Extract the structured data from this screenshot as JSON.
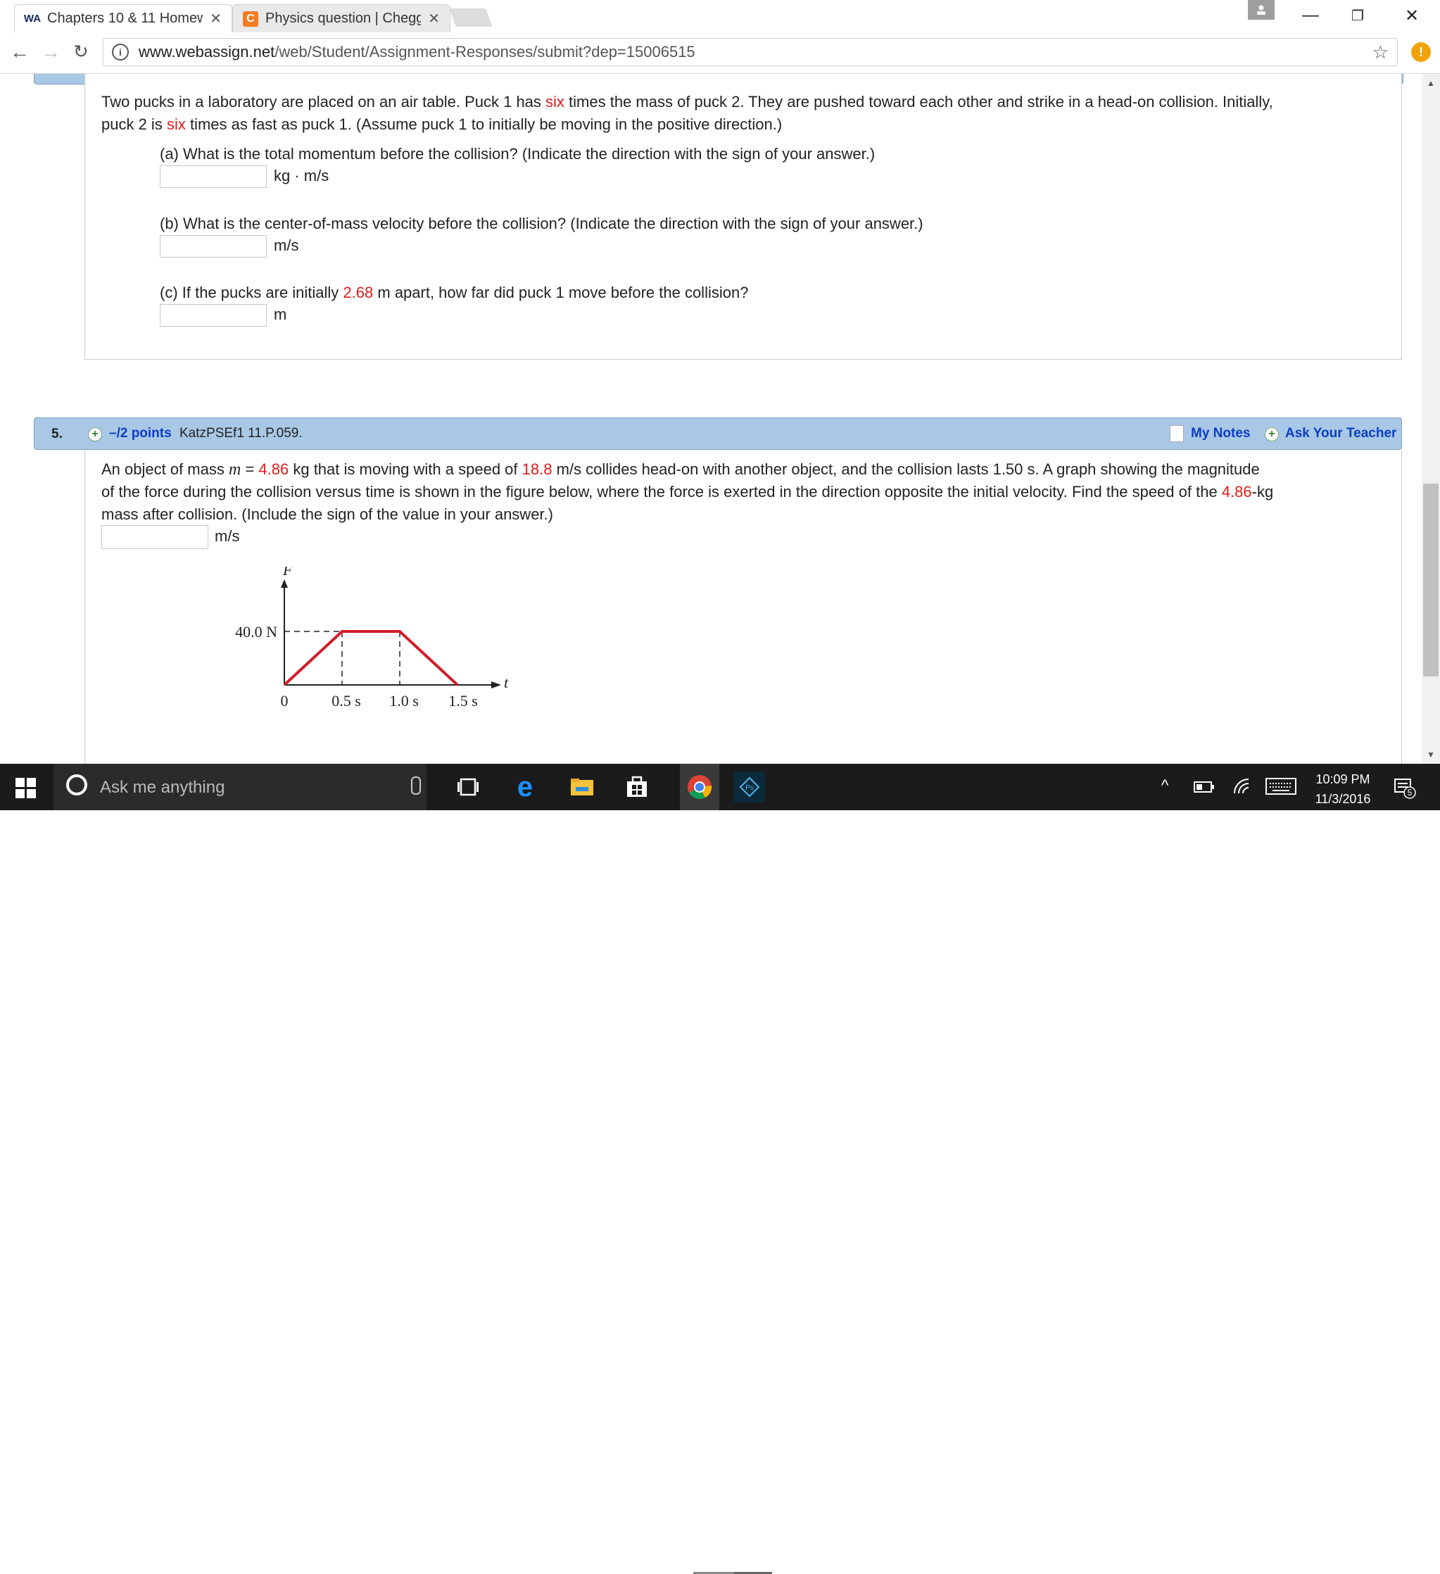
{
  "browser": {
    "tabs": [
      {
        "label": "Chapters 10 & 11 Homew",
        "favicon": "WA",
        "active": true
      },
      {
        "label": "Physics question | Chegg",
        "favicon": "C",
        "active": false
      }
    ],
    "url_host": "www.webassign.net",
    "url_path": "/web/Student/Assignment-Responses/submit?dep=15006515",
    "extension_badge": "!"
  },
  "q4": {
    "text_1": "Two pucks in a laboratory are placed on an air table. Puck 1 has ",
    "mass_ratio_word": "six",
    "text_2": " times the mass of puck 2. They are pushed toward each other and strike in a head-on collision. Initially,",
    "text_3": "puck 2 is ",
    "speed_ratio_word": "six",
    "text_4": " times as fast as puck 1. (Assume puck 1 to initially be moving in the positive direction.)",
    "part_a": "(a) What is the total momentum before the collision? (Indicate the direction with the sign of your answer.)",
    "part_a_unit": "kg · m/s",
    "part_b": "(b) What is the center-of-mass velocity before the collision? (Indicate the direction with the sign of your answer.)",
    "part_b_unit": "m/s",
    "part_c_1": "(c) If the pucks are initially ",
    "part_c_distance": "2.68",
    "part_c_2": " m apart, how far did puck 1 move before the collision?",
    "part_c_unit": "m"
  },
  "q5": {
    "number": "5.",
    "points": "–/2 points",
    "code": "KatzPSEf1 11.P.059.",
    "my_notes": "My Notes",
    "ask_teacher": "Ask Your Teacher",
    "t1": "An object of mass ",
    "m_symbol": "m",
    "eq": " = ",
    "mass": "4.86",
    "t2": " kg  that is moving with a speed of ",
    "speed": "18.8",
    "t3": " m/s collides head-on with another object, and the collision lasts 1.50 s. A graph showing the magnitude",
    "t4": "of the force during the collision versus time is shown in the figure below, where the force is exerted in the direction opposite the initial velocity. Find the speed of the ",
    "mass2": "4.86",
    "t5": "-kg",
    "t6": "mass after collision. (Include the sign of the value in your answer.)",
    "answer_unit": "m/s",
    "graph": {
      "y_axis_label": "F",
      "x_axis_label": "t",
      "y_tick": "40.0 N",
      "x_ticks": [
        "0",
        "0.5 s",
        "1.0 s",
        "1.5 s"
      ],
      "line_color": "#d11f2a"
    }
  },
  "taskbar": {
    "search_placeholder": "Ask me anything",
    "time": "10:09 PM",
    "date": "11/3/2016",
    "notification_count": "5"
  }
}
